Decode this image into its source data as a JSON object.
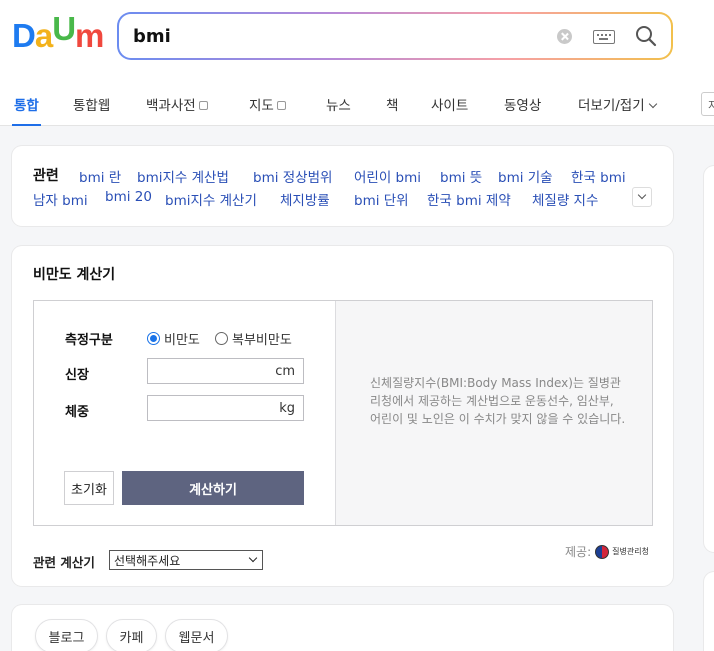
{
  "logo": {
    "d": "D",
    "a": "a",
    "u": "U",
    "m": "m"
  },
  "search": {
    "query": "bmi"
  },
  "nav": {
    "items": [
      "통합",
      "통합웹",
      "백과사전",
      "지도",
      "뉴스",
      "책",
      "사이트",
      "동영상",
      "더보기/접기"
    ],
    "active": "통합",
    "edge": "지"
  },
  "related": {
    "title": "관련",
    "links": [
      "bmi 란",
      "bmi지수 계산법",
      "bmi 정상범위",
      "어린이 bmi",
      "bmi 뜻",
      "bmi 기술",
      "한국 bmi",
      "남자 bmi",
      "bmi 20",
      "bmi지수 계산기",
      "체지방률",
      "bmi 단위",
      "한국 bmi 제약",
      "체질량 지수"
    ]
  },
  "calculator": {
    "title": "비만도 계산기",
    "measure_label": "측정구분",
    "options": [
      "비만도",
      "복부비만도"
    ],
    "selected_option": "비만도",
    "height_label": "신장",
    "height_unit": "cm",
    "weight_label": "체중",
    "weight_unit": "kg",
    "reset_label": "초기화",
    "calc_label": "계산하기",
    "description": "신체질량지수(BMI:Body Mass Index)는 질병관리청에서 제공하는 계산법으로 운동선수, 임산부, 어린이 및 노인은 이 수치가 맞지 않을 수 있습니다.",
    "provider_prefix": "제공:",
    "provider_name": "질병관리청",
    "related_calc_label": "관련 계산기",
    "related_calc_value": "선택해주세요"
  },
  "result_tabs": [
    "블로그",
    "카페",
    "웹문서"
  ],
  "colors": {
    "accent": "#1e6ee8",
    "link": "#2a4fb6",
    "calc_button": "#5e6480"
  }
}
